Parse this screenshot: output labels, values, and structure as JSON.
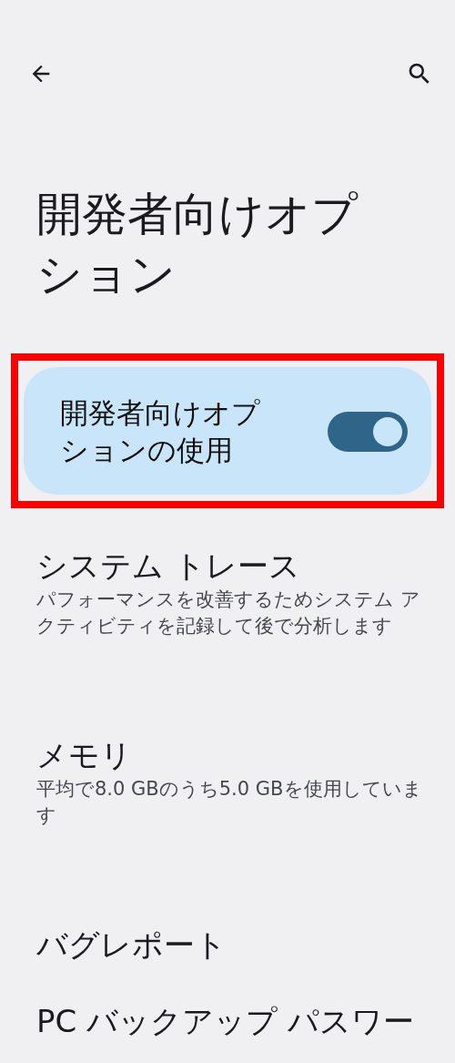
{
  "title": "開発者向けオプション",
  "main_switch": {
    "label": "開発者向けオプションの使用",
    "on": true,
    "highlighted": true
  },
  "items": [
    {
      "title": "システム トレース",
      "summary": "パフォーマンスを改善するためシステム アクティビティを記録して後で分析します"
    },
    {
      "title": "メモリ",
      "summary": "平均で8.0 GBのうち5.0 GBを使用しています"
    },
    {
      "title": "バグレポート"
    },
    {
      "title": "PC バックアップ パスワー"
    }
  ]
}
